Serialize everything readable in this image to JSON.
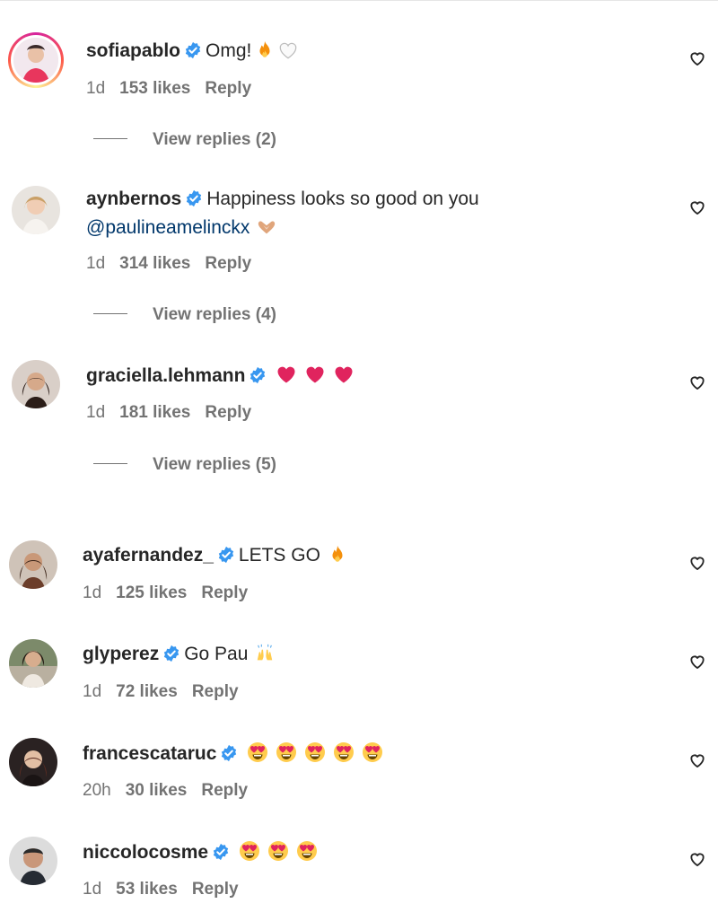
{
  "comments": [
    {
      "username": "sofiapablo",
      "text": "Omg!",
      "time": "1d",
      "likes": "153 likes",
      "reply": "Reply",
      "view_replies": "View replies (2)"
    },
    {
      "username": "aynbernos",
      "text": "Happiness looks so good on you",
      "mention": "@paulineamelinckx",
      "time": "1d",
      "likes": "314 likes",
      "reply": "Reply",
      "view_replies": "View replies (4)"
    },
    {
      "username": "graciella.lehmann",
      "text": "",
      "time": "1d",
      "likes": "181 likes",
      "reply": "Reply",
      "view_replies": "View replies (5)"
    },
    {
      "username": "ayafernandez_",
      "text": "LETS GO",
      "time": "1d",
      "likes": "125 likes",
      "reply": "Reply"
    },
    {
      "username": "glyperez",
      "text": "Go Pau",
      "time": "1d",
      "likes": "72 likes",
      "reply": "Reply"
    },
    {
      "username": "francescataruc",
      "text": "",
      "time": "20h",
      "likes": "30 likes",
      "reply": "Reply"
    },
    {
      "username": "niccolocosme",
      "text": "",
      "time": "1d",
      "likes": "53 likes",
      "reply": "Reply"
    }
  ],
  "colors": {
    "verified": "#3897f0",
    "heart_red": "#ed4956",
    "muted": "#737373",
    "mention": "#00376b"
  },
  "icons": {
    "verified": "verified-badge-icon",
    "like": "heart-outline-icon",
    "fire": "fire-emoji-icon",
    "heart_eyes": "heart-eyes-emoji-icon"
  }
}
